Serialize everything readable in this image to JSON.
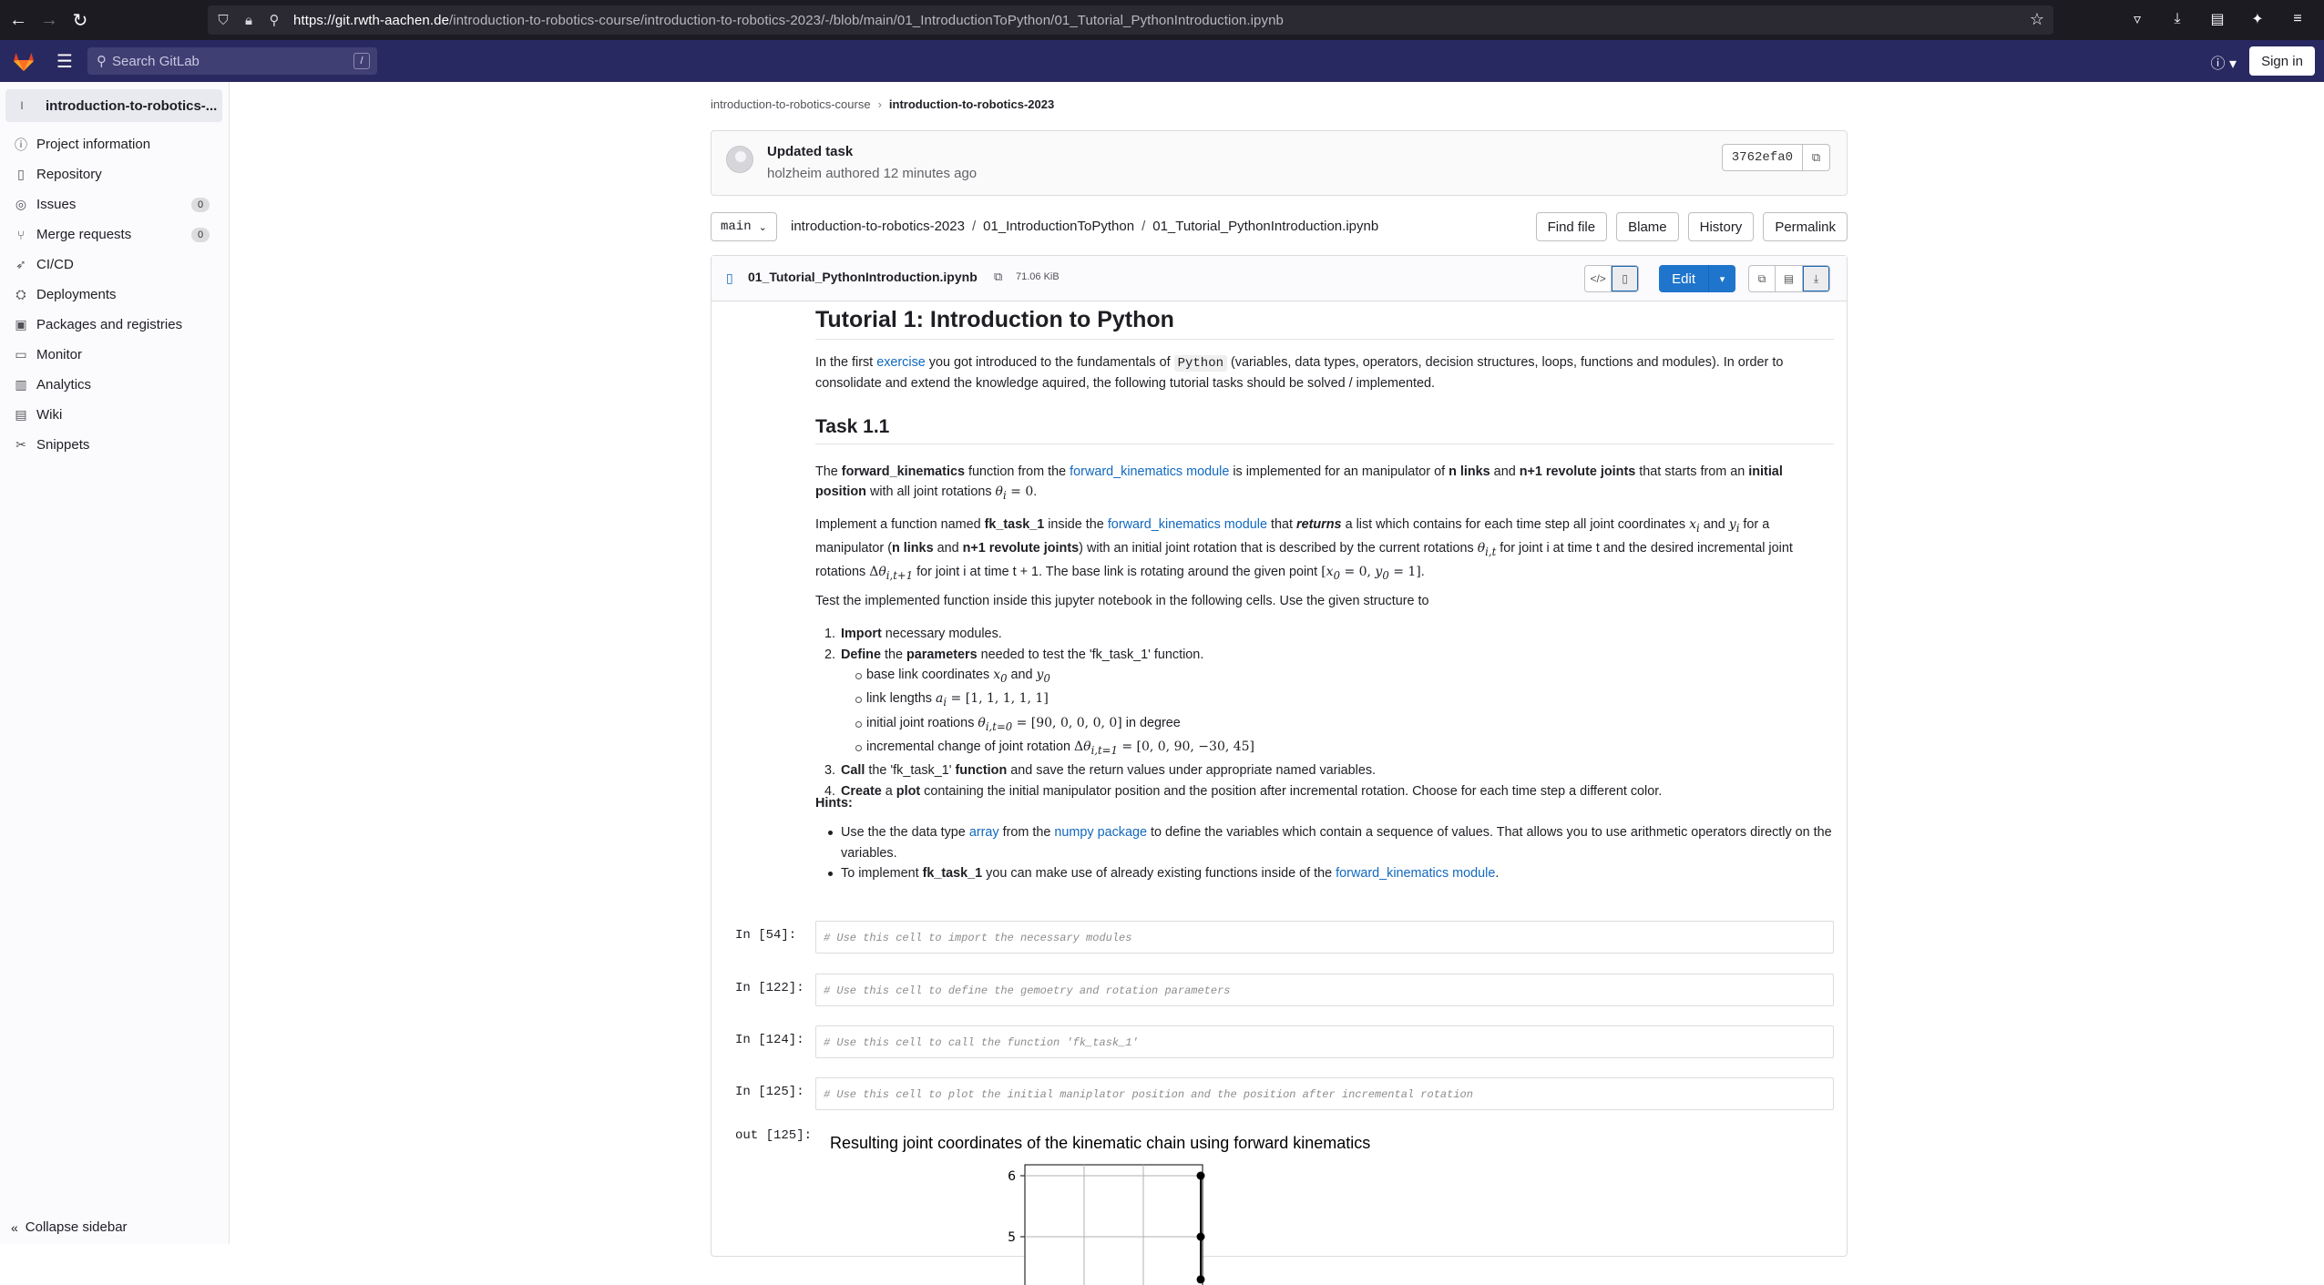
{
  "browser": {
    "url_host": "https://git.rwth-aachen.de",
    "url_path": "/introduction-to-robotics-course/introduction-to-robotics-2023/-/blob/main/01_IntroductionToPython/01_Tutorial_PythonIntroduction.ipynb"
  },
  "header": {
    "search_placeholder": "Search GitLab",
    "search_shortcut": "/",
    "sign_in": "Sign in"
  },
  "sidebar": {
    "project_initial": "I",
    "project_name": "introduction-to-robotics-...",
    "items": [
      {
        "label": "Project information",
        "icon": "info-icon"
      },
      {
        "label": "Repository",
        "icon": "doc-icon"
      },
      {
        "label": "Issues",
        "icon": "issues-icon",
        "badge": "0"
      },
      {
        "label": "Merge requests",
        "icon": "merge-icon",
        "badge": "0"
      },
      {
        "label": "CI/CD",
        "icon": "rocket-icon"
      },
      {
        "label": "Deployments",
        "icon": "deploy-icon"
      },
      {
        "label": "Packages and registries",
        "icon": "package-icon"
      },
      {
        "label": "Monitor",
        "icon": "monitor-icon"
      },
      {
        "label": "Analytics",
        "icon": "chart-icon"
      },
      {
        "label": "Wiki",
        "icon": "book-icon"
      },
      {
        "label": "Snippets",
        "icon": "snippet-icon"
      }
    ],
    "collapse": "Collapse sidebar"
  },
  "breadcrumb": {
    "course": "introduction-to-robotics-course",
    "project": "introduction-to-robotics-2023"
  },
  "commit": {
    "title": "Updated task",
    "meta": "holzheim authored 12 minutes ago",
    "sha": "3762efa0"
  },
  "pathbar": {
    "branch": "main",
    "path": [
      "introduction-to-robotics-2023",
      "01_IntroductionToPython",
      "01_Tutorial_PythonIntroduction.ipynb"
    ],
    "actions": [
      "Find file",
      "Blame",
      "History",
      "Permalink"
    ]
  },
  "file": {
    "name": "01_Tutorial_PythonIntroduction.ipynb",
    "size": "71.06 KiB",
    "edit": "Edit"
  },
  "notebook": {
    "title": "Tutorial 1: Introduction to Python",
    "task_heading": "Task 1.1",
    "hints_label": "Hints:",
    "cells": [
      {
        "prompt": "In [54]:",
        "code": "# Use this cell to import the necessary modules"
      },
      {
        "prompt": "In [122]:",
        "code": "# Use this cell to define the gemoetry and rotation parameters"
      },
      {
        "prompt": "In [124]:",
        "code": "# Use this cell to call the function 'fk_task_1'"
      },
      {
        "prompt": "In [125]:",
        "code": "# Use this cell to plot the initial maniplator position and the position after incremental rotation"
      }
    ],
    "out_prompt": "out [125]:"
  },
  "chart_data": {
    "type": "line",
    "title": "Resulting joint coordinates of the kinematic chain using forward kinematics",
    "y_ticks": [
      6,
      5
    ],
    "series": [
      {
        "points": [
          [
            3,
            6
          ],
          [
            3,
            5
          ],
          [
            3,
            4.3
          ]
        ]
      }
    ],
    "grid": true
  }
}
